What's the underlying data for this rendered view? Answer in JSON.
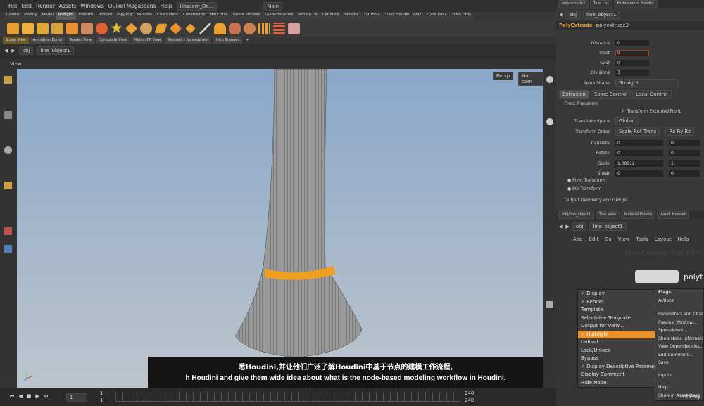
{
  "menubar": {
    "items": [
      "File",
      "Edit",
      "Render",
      "Assets",
      "Windows",
      "Quixel Megascans",
      "Help"
    ],
    "project": "Hossam_De...",
    "desktop": "Main"
  },
  "shelf_tabs": [
    "Create",
    "Modify",
    "Model",
    "Polygon",
    "Deform",
    "Texture",
    "Rigging",
    "Muscles",
    "Characters",
    "Constraints",
    "Hair Utils",
    "Guide Process",
    "Guide Brushes",
    "Terrain FX",
    "Cloud FX",
    "Volume",
    "TD Tools",
    "TOPs Houdini Tools",
    "TOPs Tools",
    "TOPs Utils"
  ],
  "pane_tabs": [
    "Scene View",
    "Animation Editor",
    "Render View",
    "Composite View",
    "Motion FX View",
    "Geometry Spreadsheet",
    "Help Browser"
  ],
  "path": {
    "root": "obj",
    "node": "line_object1"
  },
  "viewport": {
    "title": "View",
    "camera_mode": "Persp",
    "camera": "No cam"
  },
  "subtitles": {
    "cn": "悉Houdini,并让他们广泛了解Houdini中基于节点的建模工作流程,",
    "en": "h Houdini and give them wide idea about what is the node-based modeling workflow in Houdini,"
  },
  "timeline": {
    "frame": "1",
    "start": "1",
    "start2": "1",
    "end": "240",
    "end2": "240"
  },
  "top_right": {
    "tabs": [
      "polyextrude2",
      "Take List",
      "Performance Monitor"
    ],
    "path_root": "obj",
    "path_node": "line_object1",
    "node_type": "PolyExtrude",
    "node_name": "polyextrude2",
    "params": [
      {
        "label": "Distance",
        "value": "0"
      },
      {
        "label": "Inset",
        "value": "0"
      },
      {
        "label": "Twist",
        "value": "0"
      },
      {
        "label": "Divisions",
        "value": "3"
      }
    ],
    "spine_shape_label": "Spine Shape",
    "spine_shape_value": "Straight",
    "sub_tabs": [
      "Extrusion",
      "Spine Control",
      "Local Control"
    ],
    "front_transform_label": "Front Transform",
    "transform_extruded_front": "Transform Extruded Front",
    "transform_space_label": "Transform Space",
    "transform_space_value": "Global",
    "transform_order_label": "Transform Order",
    "transform_order_value": "Scale Rot Trans",
    "rot_order_value": "Rx Ry Rz",
    "xform": [
      {
        "label": "Translate",
        "a": "0",
        "b": "0"
      },
      {
        "label": "Rotate",
        "a": "0",
        "b": "0"
      },
      {
        "label": "Scale",
        "a": "1.08912",
        "b": "1"
      },
      {
        "label": "Shear",
        "a": "0",
        "b": "0"
      }
    ],
    "pivot_transform": "Pivot Transform",
    "pre_transform": "Pre-Transform",
    "output_groups": "Output Geometry and Groups"
  },
  "bottom_right": {
    "tabs": [
      "/obj/line_object1",
      "Tree View",
      "Material Palette",
      "Asset Browser"
    ],
    "path_root": "obj",
    "path_node": "line_object1",
    "menu": [
      "Add",
      "Edit",
      "Go",
      "View",
      "Tools",
      "Layout",
      "Help"
    ],
    "watermark": "Non-Commercial Edit",
    "node_label": "polyt",
    "context_menu": [
      {
        "label": "✓ Display",
        "hl": false
      },
      {
        "label": "✓ Render",
        "hl": false
      },
      {
        "label": "Template",
        "hl": false
      },
      {
        "label": "Selectable Template",
        "hl": false
      },
      {
        "label": "Output for View...",
        "hl": false
      },
      {
        "label": "✓ Highlight",
        "hl": true
      },
      {
        "label": "Unload",
        "hl": false
      },
      {
        "label": "Lock/Unlock",
        "hl": false
      },
      {
        "label": "Bypass",
        "hl": false
      },
      {
        "label": "✓ Display Descriptive Parameter",
        "hl": false
      },
      {
        "label": "Display Comment",
        "hl": false
      },
      {
        "label": "Hide Node",
        "hl": false
      }
    ],
    "side_menu": [
      "Flags",
      "Actions",
      "Parameters and Char",
      "Preview Window...",
      "Spreadsheet...",
      "Show Node Informati",
      "View Dependencies...",
      "Edit Comment...",
      "Save",
      "Inputs",
      "Help...",
      "Show in Asset Mana"
    ],
    "udemy": "Udemy"
  },
  "colors": {
    "accent": "#e8902a",
    "viewport_top": "#8aa7c9",
    "viewport_bottom": "#bcc5cc"
  }
}
